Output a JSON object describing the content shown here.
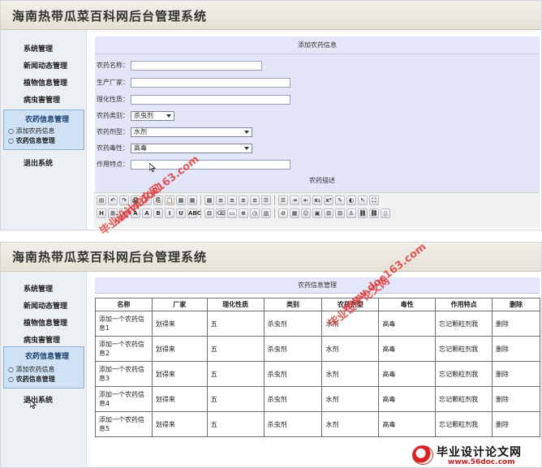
{
  "app_title": "海南热带瓜菜百科网后台管理系统",
  "sidebar": {
    "items": [
      "系统管理",
      "新闻动态管理",
      "植物信息管理",
      "病虫害管理"
    ],
    "group_title": "农药信息管理",
    "group_subitems": [
      "添加农药信息",
      "农药信息管理"
    ],
    "logout": "退出系统"
  },
  "add_form": {
    "title": "添加农药信息",
    "name_label": "农药名称：",
    "maker_label": "生产厂家：",
    "prop_label": "理化性质：",
    "category_label": "农药类别：",
    "category_value": "杀虫剂",
    "dosage_label": "农药剂型：",
    "dosage_value": "水剂",
    "toxicity_label": "农药毒性：",
    "toxicity_value": "高毒",
    "feature_label": "作用特点：",
    "desc_label": "农药描述"
  },
  "toolbar_row1": [
    "▤",
    "↶",
    "↷",
    "🖨",
    "✂",
    "⎘",
    "📋",
    "▦",
    "▦",
    "▦",
    "≡",
    "≡",
    "≡",
    "≡",
    "☰",
    "☰",
    "⇥",
    "⇤",
    "x₁",
    "x²",
    "✎",
    "◐",
    "↖",
    "⛶"
  ],
  "toolbar_row2": [
    "H",
    "⊞",
    "▾",
    "A",
    "A",
    "B",
    "I",
    "U",
    "ABC",
    "⊟",
    "⌫",
    "▭",
    "⊕",
    "◷",
    "▥",
    "⊘",
    "▦",
    "☺",
    "▣",
    "⊡",
    "⊡",
    "⚓",
    "⛓",
    "⛓",
    "▯"
  ],
  "list": {
    "title": "农药信息管理",
    "columns": [
      "名称",
      "厂家",
      "理化性质",
      "类别",
      "农药剂型",
      "毒性",
      "作用特点",
      "删除"
    ],
    "rows": [
      [
        "添加一个农药信息1",
        "划得来",
        "五",
        "杀虫剂",
        "水剂",
        "高毒",
        "忘记颗粒剂我",
        "删除"
      ],
      [
        "添加一个农药信息2",
        "划得来",
        "五",
        "杀虫剂",
        "水剂",
        "高毒",
        "忘记颗粒剂我",
        "删除"
      ],
      [
        "添加一个农药信息3",
        "划得来",
        "五",
        "杀虫剂",
        "水剂",
        "高毒",
        "忘记颗粒剂我",
        "删除"
      ],
      [
        "添加一个农药信息4",
        "划得来",
        "五",
        "杀虫剂",
        "水剂",
        "高毒",
        "忘记颗粒剂我",
        "删除"
      ],
      [
        "添加一个农药信息5",
        "划得来",
        "五",
        "杀虫剂",
        "水剂",
        "高毒",
        "忘记颗粒剂我",
        "删除"
      ]
    ]
  },
  "watermarks": {
    "cn": "毕业设计论文网",
    "url": "www.doc163.com"
  },
  "logo": {
    "title": "毕业设计论文网",
    "url": "www.56doc.com"
  }
}
